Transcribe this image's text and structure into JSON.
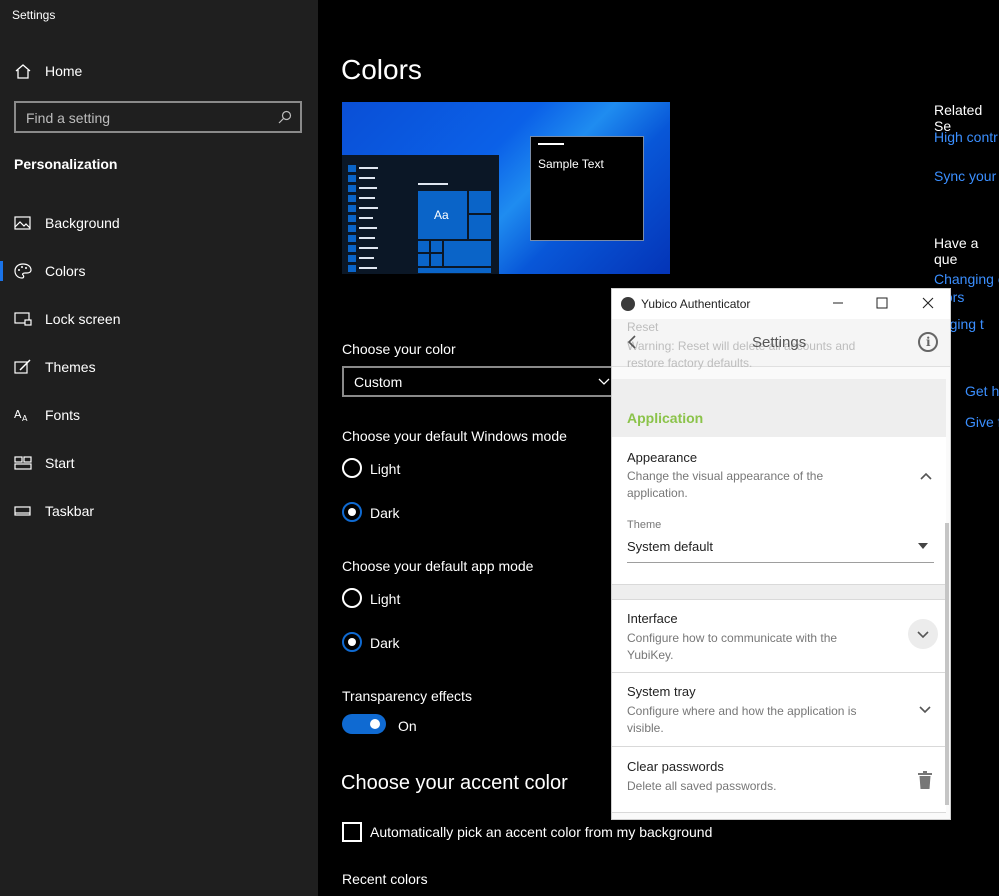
{
  "window": {
    "title": "Settings"
  },
  "sidebar": {
    "home_label": "Home",
    "search_placeholder": "Find a setting",
    "section_title": "Personalization",
    "items": [
      {
        "label": "Background",
        "icon": "picture-icon"
      },
      {
        "label": "Colors",
        "icon": "palette-icon",
        "active": true
      },
      {
        "label": "Lock screen",
        "icon": "lock-screen-icon"
      },
      {
        "label": "Themes",
        "icon": "themes-icon"
      },
      {
        "label": "Fonts",
        "icon": "fonts-icon"
      },
      {
        "label": "Start",
        "icon": "start-icon"
      },
      {
        "label": "Taskbar",
        "icon": "taskbar-icon"
      }
    ]
  },
  "main": {
    "title": "Colors",
    "preview_sample_text": "Sample Text",
    "preview_tile_label": "Aa",
    "choose_color_label": "Choose your color",
    "choose_color_value": "Custom",
    "windows_mode_label": "Choose your default Windows mode",
    "windows_mode_options": [
      "Light",
      "Dark"
    ],
    "windows_mode_selected": "Dark",
    "app_mode_label": "Choose your default app mode",
    "app_mode_options": [
      "Light",
      "Dark"
    ],
    "app_mode_selected": "Dark",
    "transparency_label": "Transparency effects",
    "transparency_state": "On",
    "accent_title": "Choose your accent color",
    "auto_accent_label": "Automatically pick an accent color from my background",
    "recent_colors_label": "Recent colors"
  },
  "related": {
    "heading": "Related Se",
    "links": [
      "High contr",
      "Sync your s"
    ],
    "question_heading": "Have a que",
    "question_links": [
      "Changing c",
      "olors",
      "anging t"
    ],
    "help_links": [
      "Get h",
      "Give f"
    ]
  },
  "yubico": {
    "title": "Yubico Authenticator",
    "header_title": "Settings",
    "ghost_reset_title": "Reset",
    "ghost_reset_desc_line1": "Warning: Reset will delete all accounts and",
    "ghost_reset_desc_line2": "restore factory defaults.",
    "section_label": "Application",
    "appearance": {
      "title": "Appearance",
      "desc": "Change the visual appearance of the application.",
      "theme_label": "Theme",
      "theme_value": "System default"
    },
    "interface": {
      "title": "Interface",
      "desc": "Configure how to communicate with the YubiKey."
    },
    "system_tray": {
      "title": "System tray",
      "desc": "Configure where and how the application is visible."
    },
    "clear_passwords": {
      "title": "Clear passwords",
      "desc": "Delete all saved passwords."
    }
  },
  "colors": {
    "accent": "#0f6ad2",
    "link": "#3b8fff",
    "yubico_green": "#8bc34a",
    "sidebar_bg": "#1f1f1f"
  }
}
